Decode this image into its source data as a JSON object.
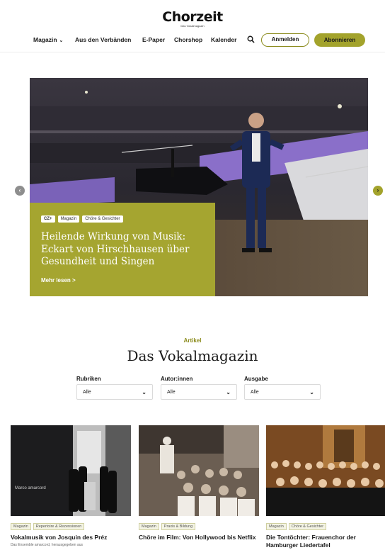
{
  "header": {
    "logo": "Chorzeit",
    "logo_sub": "Das Vokalmagazin",
    "nav": [
      {
        "label": "Magazin",
        "has_dropdown": true
      },
      {
        "label": "Aus den Verbänden"
      },
      {
        "label": "E-Paper"
      },
      {
        "label": "Chorshop"
      },
      {
        "label": "Kalender"
      }
    ],
    "login_label": "Anmelden",
    "subscribe_label": "Abonnieren"
  },
  "hero": {
    "tags": [
      "CZ+",
      "Magazin",
      "Chöre & Gesichter"
    ],
    "title": "Heilende Wirkung von Musik: Eckart von Hirschhausen über Gesundheit und Singen",
    "more_label": "Mehr lesen >"
  },
  "section": {
    "kicker": "Artikel",
    "title": "Das Vokalmagazin",
    "filters": [
      {
        "label": "Rubriken",
        "value": "Alle"
      },
      {
        "label": "Autor:innen",
        "value": "Alle"
      },
      {
        "label": "Ausgabe",
        "value": "Alle"
      }
    ]
  },
  "articles": [
    {
      "tags": [
        "Magazin",
        "Repertoire & Rezensionen"
      ],
      "title": "Vokalmusik von Josquin des Préz",
      "excerpt": "Das Ensemble amarcord, herausgegeben aus"
    },
    {
      "tags": [
        "Magazin",
        "Praxis & Bildung"
      ],
      "title": "Chöre im Film: Von Hollywood bis Netflix",
      "excerpt": ""
    },
    {
      "tags": [
        "Magazin",
        "Chöre & Gesichter"
      ],
      "title": "Die Tontöchter: Frauenchor der Hamburger Liedertafel",
      "excerpt": ""
    }
  ],
  "colors": {
    "accent": "#a3a32c",
    "accent_dark": "#8b8b1c"
  },
  "icons": {
    "search": "search-icon",
    "prev": "chevron-left-icon",
    "next": "chevron-right-icon"
  }
}
